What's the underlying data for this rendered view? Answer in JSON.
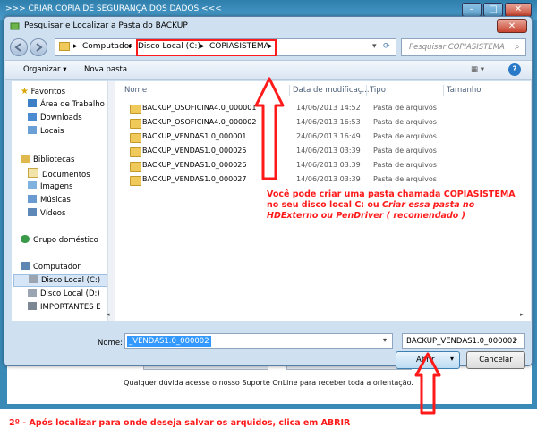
{
  "main_window": {
    "title": ">>> CRIAR COPIA DE SEGURANÇA DOS DADOS <<<",
    "footer_text": "Qualquer dúvida acesse o nosso Suporte OnLine para receber toda a orientação."
  },
  "dialog": {
    "title": "Pesquisar e Localizar a Pasta do BACKUP",
    "close_label": "✕",
    "breadcrumb": [
      "Computador",
      "Disco Local (C:)",
      "COPIASISTEMA"
    ],
    "search_placeholder": "Pesquisar COPIASISTEMA",
    "toolbar": {
      "organize": "Organizar ▾",
      "new_folder": "Nova pasta"
    },
    "nav": {
      "favorites": "Favoritos",
      "favorites_items": [
        "Área de Trabalho",
        "Downloads",
        "Locais"
      ],
      "libraries": "Bibliotecas",
      "libraries_items": [
        "Documentos",
        "Imagens",
        "Músicas",
        "Vídeos"
      ],
      "homegroup": "Grupo doméstico",
      "computer": "Computador",
      "computer_items": [
        "Disco Local (C:)",
        "Disco Local (D:)",
        "IMPORTANTES E"
      ]
    },
    "columns": {
      "name": "Nome",
      "date": "Data de modificaç...",
      "type": "Tipo",
      "size": "Tamanho"
    },
    "files": [
      {
        "name": "BACKUP_OSOFICINA4.0_000001",
        "date": "14/06/2013 14:52",
        "type": "Pasta de arquivos"
      },
      {
        "name": "BACKUP_OSOFICINA4.0_000002",
        "date": "14/06/2013 16:53",
        "type": "Pasta de arquivos"
      },
      {
        "name": "BACKUP_VENDAS1.0_000001",
        "date": "24/06/2013 16:49",
        "type": "Pasta de arquivos"
      },
      {
        "name": "BACKUP_VENDAS1.0_000025",
        "date": "14/06/2013 03:39",
        "type": "Pasta de arquivos"
      },
      {
        "name": "BACKUP_VENDAS1.0_000026",
        "date": "14/06/2013 03:39",
        "type": "Pasta de arquivos"
      },
      {
        "name": "BACKUP_VENDAS1.0_000027",
        "date": "14/06/2013 03:39",
        "type": "Pasta de arquivos"
      }
    ],
    "filename_label": "Nome:",
    "filename_value": "_VENDAS1.0_000002",
    "filetype_value": "BACKUP_VENDAS1.0_000002",
    "open_label": "Abrir",
    "cancel_label": "Cancelar"
  },
  "annotations": {
    "note_line1": "Você pode criar uma pasta chamada COPIASISTEMA",
    "note_line2": "no seu disco local C: ou",
    "note_line2_italic": "Criar essa pasta no",
    "note_line3": "HDExterno ou PenDriver ( recomendado )",
    "bottom_note": "2º - Após localizar para onde deseja salvar os arquidos, clica em ABRIR"
  },
  "colors": {
    "annotation_red": "#ff1a1a",
    "selection_blue": "#3399ff"
  }
}
